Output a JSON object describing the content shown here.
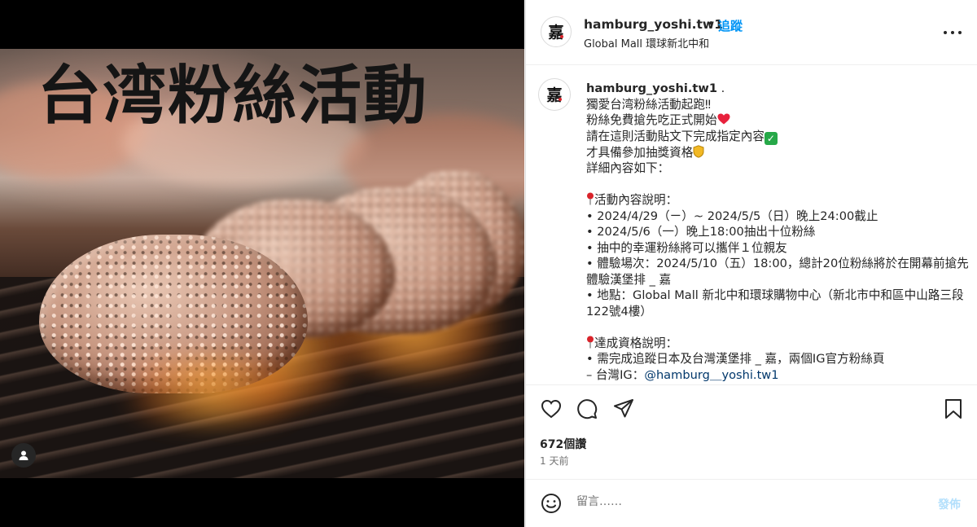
{
  "media": {
    "overlay_title": "台湾粉絲活動"
  },
  "header": {
    "username": "hamburg_yoshi.tw1",
    "separator": "•",
    "follow_label": "追蹤",
    "location": "Global Mall 環球新北中和",
    "logo_char": "嘉"
  },
  "caption": {
    "username": "hamburg_yoshi.tw1",
    "logo_char": "嘉",
    "lines": [
      " .",
      "獨愛台湾粉絲活動起跑‼",
      "粉絲免費搶先吃正式開始",
      "請在這則活動貼文下完成指定內容",
      "才具備參加抽獎資格",
      "詳細內容如下：",
      "",
      "活動內容說明：",
      "• 2024/4/29（ㄧ）~ 2024/5/5（日）晚上24:00截止",
      "• 2024/5/6（一）晚上18:00抽出十位粉絲",
      "• 抽中的幸運粉絲將可以攜伴１位親友",
      "• 體驗場次：2024/5/10（五）18:00，總計20位粉絲將於在開幕前搶先體驗漢堡排 _ 嘉",
      "• 地點：Global Mall 新北中和環球購物中心（新北市中和區中山路三段122號4樓）",
      "",
      "達成資格說明：",
      "• 需完成追蹤日本及台灣漢堡排 _ 嘉，兩個IG官方粉絲頁",
      "– 台灣IG：",
      "@hamburg＿yoshi.tw1"
    ]
  },
  "actions": {
    "likes": "672個讚",
    "time_ago": "1 天前"
  },
  "comment": {
    "placeholder": "留言……",
    "post_label": "發佈"
  },
  "icons": {
    "like": "heart-icon",
    "comment": "comment-bubble-icon",
    "share": "paper-plane-icon",
    "save": "bookmark-icon",
    "more": "more-options-icon",
    "emoji": "smiley-icon",
    "profile_badge": "user-icon"
  },
  "colors": {
    "accent": "#0095f6",
    "post_disabled": "#b2dffc",
    "text": "#262626",
    "muted": "#737373"
  }
}
